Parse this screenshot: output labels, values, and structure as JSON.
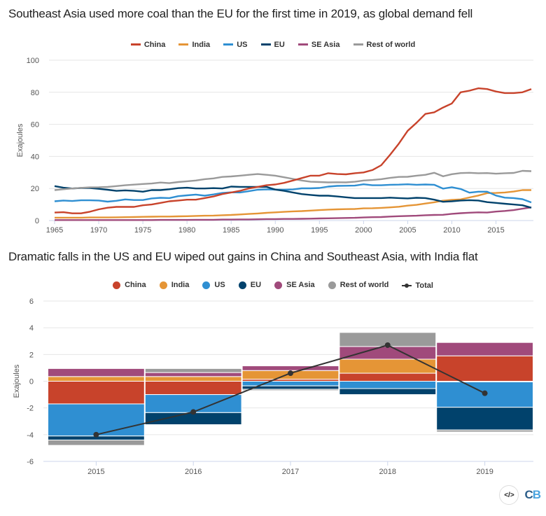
{
  "colors": {
    "China": "#c8432b",
    "India": "#e59536",
    "US": "#2f8fd2",
    "EU": "#01426c",
    "SE Asia": "#a04a7b",
    "Rest of world": "#9a9a9a",
    "Total": "#333333"
  },
  "chart_data": [
    {
      "type": "line",
      "title": "Southeast Asia used more coal than the EU for the first time in 2019, as global demand fell",
      "xlabel": "",
      "ylabel": "Exajoules",
      "ylim": [
        0,
        100
      ],
      "yticks": [
        0,
        20,
        40,
        60,
        80,
        100
      ],
      "xticks": [
        1965,
        1970,
        1975,
        1980,
        1985,
        1990,
        1995,
        2000,
        2005,
        2010,
        2015
      ],
      "grid": true,
      "legend_position": "top-center",
      "x": [
        1965,
        1966,
        1967,
        1968,
        1969,
        1970,
        1971,
        1972,
        1973,
        1974,
        1975,
        1976,
        1977,
        1978,
        1979,
        1980,
        1981,
        1982,
        1983,
        1984,
        1985,
        1986,
        1987,
        1988,
        1989,
        1990,
        1991,
        1992,
        1993,
        1994,
        1995,
        1996,
        1997,
        1998,
        1999,
        2000,
        2001,
        2002,
        2003,
        2004,
        2005,
        2006,
        2007,
        2008,
        2009,
        2010,
        2011,
        2012,
        2013,
        2014,
        2015,
        2016,
        2017,
        2018,
        2019
      ],
      "series": [
        {
          "name": "China",
          "values": [
            5,
            5.2,
            4.5,
            4.5,
            5.5,
            7,
            8,
            8.5,
            8.5,
            8.5,
            9.5,
            10,
            11,
            12,
            12.5,
            13,
            13,
            14,
            15,
            16.5,
            17.5,
            18.5,
            20,
            21,
            22,
            22.5,
            23.5,
            25,
            26.5,
            28,
            28,
            29.5,
            29,
            28.8,
            29.5,
            30,
            31.5,
            34.5,
            41,
            48,
            56,
            61,
            66.5,
            67.5,
            70.5,
            73,
            80,
            81,
            82.5,
            82,
            80.5,
            79.5,
            79.5,
            80,
            82
          ]
        },
        {
          "name": "India",
          "values": [
            1.8,
            1.8,
            1.8,
            1.8,
            1.9,
            1.9,
            1.9,
            2,
            2.1,
            2.2,
            2.3,
            2.4,
            2.5,
            2.5,
            2.6,
            2.7,
            2.9,
            3,
            3.1,
            3.3,
            3.5,
            3.8,
            4.1,
            4.4,
            4.8,
            5.1,
            5.4,
            5.7,
            5.9,
            6.2,
            6.5,
            6.8,
            7,
            7.1,
            7.2,
            7.6,
            7.7,
            7.9,
            8.2,
            8.6,
            9.3,
            9.8,
            10.6,
            11.4,
            12.4,
            12.9,
            13.2,
            14.4,
            15.6,
            17.1,
            17.2,
            17.5,
            18.1,
            19,
            19
          ]
        },
        {
          "name": "US",
          "values": [
            12,
            12.5,
            12.2,
            12.6,
            12.6,
            12.5,
            11.8,
            12.3,
            13.2,
            12.8,
            12.8,
            13.8,
            14.2,
            14,
            15.2,
            15.7,
            16.2,
            15.5,
            16.3,
            17.2,
            17.6,
            17.5,
            18.3,
            19.2,
            19.4,
            19.3,
            19.2,
            19.4,
            20.1,
            20.1,
            20.3,
            21.2,
            21.6,
            21.7,
            21.8,
            22.6,
            22,
            22,
            22.3,
            22.4,
            22.6,
            22.3,
            22.5,
            22.3,
            19.9,
            20.8,
            19.7,
            17.4,
            18,
            18,
            15.6,
            14.3,
            14,
            13.3,
            11.3
          ]
        },
        {
          "name": "EU",
          "values": [
            21.5,
            20.5,
            20,
            20.3,
            20.3,
            19.8,
            19.2,
            18.5,
            18.8,
            18.5,
            18,
            19,
            19,
            19.5,
            20.2,
            20.5,
            20,
            20,
            20.2,
            20,
            21.2,
            21,
            21,
            21,
            21,
            19.3,
            18.5,
            17.5,
            16.5,
            16,
            15.5,
            15.5,
            15,
            14.5,
            14,
            14,
            14,
            14,
            14.3,
            14,
            13.8,
            14.2,
            14,
            13,
            11.7,
            12,
            12.5,
            12.7,
            12.5,
            11.5,
            11,
            10.5,
            10,
            9.5,
            8
          ]
        },
        {
          "name": "SE Asia",
          "values": [
            0.3,
            0.3,
            0.3,
            0.3,
            0.3,
            0.3,
            0.3,
            0.3,
            0.3,
            0.3,
            0.3,
            0.3,
            0.4,
            0.4,
            0.4,
            0.4,
            0.5,
            0.5,
            0.5,
            0.6,
            0.6,
            0.7,
            0.7,
            0.8,
            0.9,
            0.9,
            1,
            1,
            1.1,
            1.2,
            1.3,
            1.4,
            1.5,
            1.6,
            1.7,
            1.9,
            2.1,
            2.2,
            2.5,
            2.7,
            2.9,
            3,
            3.3,
            3.5,
            3.6,
            4.2,
            4.6,
            4.9,
            5.1,
            5,
            5.6,
            6,
            6.5,
            7.4,
            8.2
          ]
        },
        {
          "name": "Rest of world",
          "values": [
            19,
            19.5,
            20,
            20.4,
            20.7,
            20.8,
            21,
            21.5,
            22,
            22.4,
            22.8,
            23.1,
            23.7,
            23.3,
            24,
            24.5,
            25,
            25.8,
            26.3,
            27.2,
            27.5,
            28,
            28.5,
            29,
            28.5,
            28,
            27,
            26,
            25,
            24.2,
            24,
            23.8,
            23.9,
            23.8,
            24.2,
            25,
            25.3,
            25.8,
            26.6,
            27.2,
            27.3,
            28,
            28.5,
            29.8,
            27.6,
            28.9,
            29.6,
            29.8,
            29.5,
            29.6,
            29.2,
            29.5,
            29.7,
            31,
            30.8
          ]
        }
      ]
    },
    {
      "type": "bar",
      "subtype": "stacked-waterfall",
      "title": "Dramatic falls in the US and EU wiped out gains in China and Southeast Asia, with India flat",
      "xlabel": "",
      "ylabel": "Exajoules",
      "ylim": [
        -6,
        6
      ],
      "yticks": [
        -6,
        -4,
        -2,
        0,
        2,
        4,
        6
      ],
      "categories": [
        "2015",
        "2016",
        "2017",
        "2018",
        "2019"
      ],
      "grid": true,
      "legend_position": "top-center",
      "series": [
        {
          "name": "China",
          "values": [
            -1.7,
            -1.0,
            0.15,
            0.6,
            1.9
          ]
        },
        {
          "name": "India",
          "values": [
            0.35,
            0.35,
            0.65,
            1.05,
            -0.05
          ]
        },
        {
          "name": "US",
          "values": [
            -2.4,
            -1.35,
            -0.35,
            -0.55,
            -1.9
          ]
        },
        {
          "name": "EU",
          "values": [
            -0.3,
            -0.9,
            -0.25,
            -0.45,
            -1.7
          ]
        },
        {
          "name": "SE Asia",
          "values": [
            0.6,
            0.3,
            0.35,
            0.95,
            1.0
          ]
        },
        {
          "name": "Rest of world",
          "values": [
            -0.4,
            0.3,
            -0.1,
            1.05,
            -0.15
          ]
        }
      ],
      "total": {
        "name": "Total",
        "values": [
          -4.0,
          -2.3,
          0.6,
          2.7,
          -0.9
        ]
      }
    }
  ],
  "titles": {
    "line_chart": "Southeast Asia used more coal than the EU for the first time in 2019, as global demand fell",
    "bar_chart": "Dramatic falls in the US and EU wiped out gains in China and Southeast Asia, with India flat"
  },
  "legend_line": [
    "China",
    "India",
    "US",
    "EU",
    "SE Asia",
    "Rest of world"
  ],
  "legend_bar": [
    "China",
    "India",
    "US",
    "EU",
    "SE Asia",
    "Rest of world",
    "Total"
  ],
  "footer": {
    "embed_icon": "</>",
    "logo_c": "C",
    "logo_b": "B"
  }
}
